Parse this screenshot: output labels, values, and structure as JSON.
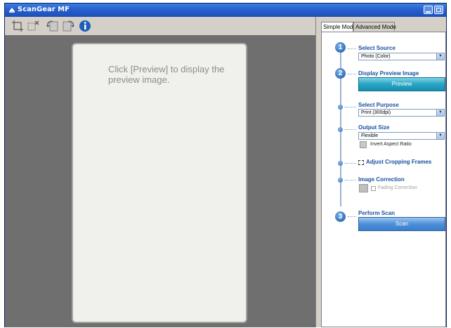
{
  "window": {
    "title": "ScanGear MF",
    "brand_color": "#2a62d0"
  },
  "toolbar": {
    "tools": [
      {
        "icon": "crop-frame-icon"
      },
      {
        "icon": "delete-crop-icon"
      },
      {
        "icon": "rotate-left-icon"
      },
      {
        "icon": "rotate-right-icon"
      },
      {
        "icon": "info-icon"
      }
    ]
  },
  "preview": {
    "hint": "Click [Preview] to display the preview image."
  },
  "tabs": [
    {
      "label": "Simple Mode",
      "active": true
    },
    {
      "label": "Advanced Mode",
      "active": false
    }
  ],
  "steps": {
    "select_source": {
      "number": "1",
      "label": "Select Source",
      "value": "Photo (Color)"
    },
    "display_preview": {
      "number": "2",
      "label": "Display Preview Image",
      "button": "Preview"
    },
    "select_purpose": {
      "label": "Select Purpose",
      "value": "Print (300dpi)"
    },
    "output_size": {
      "label": "Output Size",
      "value": "Flexible",
      "invert_label": "Invert Aspect Ratio"
    },
    "adjust_cropping": {
      "label": "Adjust Cropping Frames"
    },
    "image_correction": {
      "label": "Image Correction",
      "fading_label": "Fading Correction",
      "fading_checked": false
    },
    "perform_scan": {
      "number": "3",
      "label": "Perform Scan",
      "button": "Scan"
    }
  }
}
